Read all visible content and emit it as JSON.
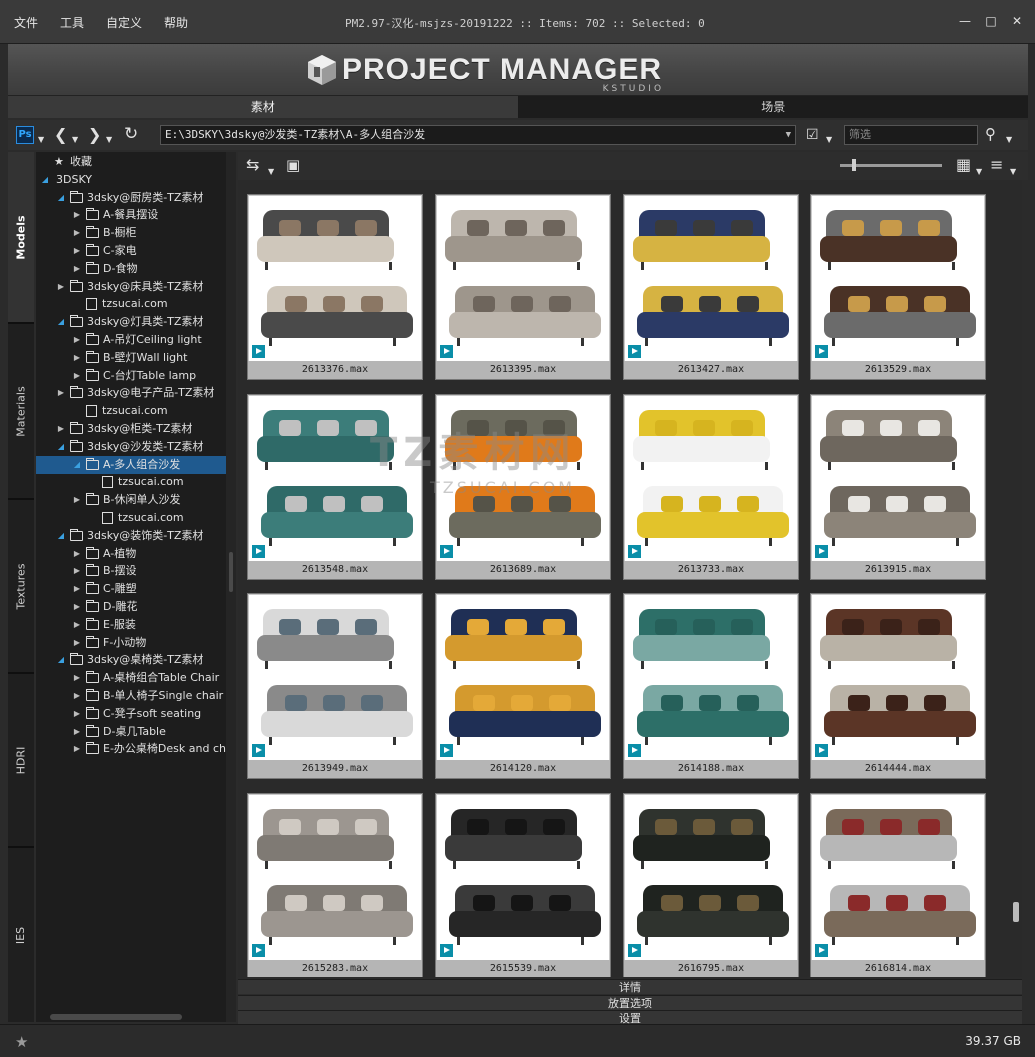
{
  "menu": [
    "文件",
    "工具",
    "自定义",
    "帮助"
  ],
  "window_title": "PM2.97-汉化-msjzs-20191222  :: Items: 702  :: Selected: 0",
  "window_controls": [
    "minimize-icon",
    "maximize-icon",
    "close-icon"
  ],
  "banner": {
    "logo_text": "PROJECT MANAGER",
    "logo_sub": "KSTUDIO"
  },
  "main_tabs": [
    {
      "label": "素材",
      "active": true
    },
    {
      "label": "场景",
      "active": false
    }
  ],
  "toolbar": {
    "ps_label": "Ps",
    "path": "E:\\3DSKY\\3dsky@沙发类-TZ素材\\A-多人组合沙发",
    "filter_placeholder": "筛选"
  },
  "side_tabs": [
    "Models",
    "Materials",
    "Textures",
    "HDRI",
    "IES"
  ],
  "tree": [
    {
      "label": "收藏",
      "indent": 0,
      "type": "fav",
      "arrow": ""
    },
    {
      "label": "3DSKY",
      "indent": 0,
      "type": "none",
      "arrow": "open"
    },
    {
      "label": "3dsky@厨房类-TZ素材",
      "indent": 1,
      "type": "folder",
      "arrow": "open"
    },
    {
      "label": "A-餐具摆设",
      "indent": 2,
      "type": "folder",
      "arrow": "closed"
    },
    {
      "label": "B-橱柜",
      "indent": 2,
      "type": "folder",
      "arrow": "closed"
    },
    {
      "label": "C-家电",
      "indent": 2,
      "type": "folder",
      "arrow": "closed"
    },
    {
      "label": "D-食物",
      "indent": 2,
      "type": "folder",
      "arrow": "closed"
    },
    {
      "label": "3dsky@床具类-TZ素材",
      "indent": 1,
      "type": "folder",
      "arrow": "closed"
    },
    {
      "label": "tzsucai.com",
      "indent": 2,
      "type": "file",
      "arrow": ""
    },
    {
      "label": "3dsky@灯具类-TZ素材",
      "indent": 1,
      "type": "folder",
      "arrow": "open"
    },
    {
      "label": "A-吊灯Ceiling light",
      "indent": 2,
      "type": "folder",
      "arrow": "closed"
    },
    {
      "label": "B-壁灯Wall light",
      "indent": 2,
      "type": "folder",
      "arrow": "closed"
    },
    {
      "label": "C-台灯Table lamp",
      "indent": 2,
      "type": "folder",
      "arrow": "closed"
    },
    {
      "label": "3dsky@电子产品-TZ素材",
      "indent": 1,
      "type": "folder",
      "arrow": "closed"
    },
    {
      "label": "tzsucai.com",
      "indent": 2,
      "type": "file",
      "arrow": ""
    },
    {
      "label": "3dsky@柜类-TZ素材",
      "indent": 1,
      "type": "folder",
      "arrow": "closed"
    },
    {
      "label": "3dsky@沙发类-TZ素材",
      "indent": 1,
      "type": "folder",
      "arrow": "open"
    },
    {
      "label": "A-多人组合沙发",
      "indent": 2,
      "type": "folder",
      "arrow": "open",
      "selected": true
    },
    {
      "label": "tzsucai.com",
      "indent": 3,
      "type": "file",
      "arrow": ""
    },
    {
      "label": "B-休闲单人沙发",
      "indent": 2,
      "type": "folder",
      "arrow": "closed"
    },
    {
      "label": "tzsucai.com",
      "indent": 3,
      "type": "file",
      "arrow": ""
    },
    {
      "label": "3dsky@装饰类-TZ素材",
      "indent": 1,
      "type": "folder",
      "arrow": "open"
    },
    {
      "label": "A-植物",
      "indent": 2,
      "type": "folder",
      "arrow": "closed"
    },
    {
      "label": "B-摆设",
      "indent": 2,
      "type": "folder",
      "arrow": "closed"
    },
    {
      "label": "C-雕塑",
      "indent": 2,
      "type": "folder",
      "arrow": "closed"
    },
    {
      "label": "D-雕花",
      "indent": 2,
      "type": "folder",
      "arrow": "closed"
    },
    {
      "label": "E-服装",
      "indent": 2,
      "type": "folder",
      "arrow": "closed"
    },
    {
      "label": "F-小动物",
      "indent": 2,
      "type": "folder",
      "arrow": "closed"
    },
    {
      "label": "3dsky@桌椅类-TZ素材",
      "indent": 1,
      "type": "folder",
      "arrow": "open"
    },
    {
      "label": "A-桌椅组合Table Chair",
      "indent": 2,
      "type": "folder",
      "arrow": "closed"
    },
    {
      "label": "B-单人椅子Single chair",
      "indent": 2,
      "type": "folder",
      "arrow": "closed"
    },
    {
      "label": "C-凳子soft seating",
      "indent": 2,
      "type": "folder",
      "arrow": "closed"
    },
    {
      "label": "D-桌几Table",
      "indent": 2,
      "type": "folder",
      "arrow": "closed"
    },
    {
      "label": "E-办公桌椅Desk and chair",
      "indent": 2,
      "type": "folder",
      "arrow": "closed"
    }
  ],
  "items": [
    {
      "file": "2613376.max",
      "palette": [
        "#4a4a4a",
        "#cfc7bb",
        "#8b7764"
      ]
    },
    {
      "file": "2613395.max",
      "palette": [
        "#bdb6ad",
        "#9e968c",
        "#6e655c"
      ]
    },
    {
      "file": "2613427.max",
      "palette": [
        "#2b3a66",
        "#d6b342",
        "#3a3a3a"
      ]
    },
    {
      "file": "2613529.max",
      "palette": [
        "#6b6b6b",
        "#4a3226",
        "#c79a4a"
      ]
    },
    {
      "file": "2613548.max",
      "palette": [
        "#3c7d7a",
        "#2f6a68",
        "#c0c0c0"
      ]
    },
    {
      "file": "2613689.max",
      "palette": [
        "#6c6b5e",
        "#e07a1a",
        "#555348"
      ]
    },
    {
      "file": "2613733.max",
      "palette": [
        "#e2c32b",
        "#f2f2f2",
        "#d6b41f"
      ]
    },
    {
      "file": "2613915.max",
      "palette": [
        "#8c8479",
        "#6e675e",
        "#e8e6e2"
      ]
    },
    {
      "file": "2613949.max",
      "palette": [
        "#d9d9d9",
        "#8a8a8a",
        "#5a6d7a"
      ]
    },
    {
      "file": "2614120.max",
      "palette": [
        "#1f2f55",
        "#d49a2e",
        "#e4a938"
      ]
    },
    {
      "file": "2614188.max",
      "palette": [
        "#2d6f68",
        "#7aa8a3",
        "#26605a"
      ]
    },
    {
      "file": "2614444.max",
      "palette": [
        "#5b3526",
        "#b9b2a6",
        "#3b2219"
      ]
    },
    {
      "file": "2615283.max",
      "palette": [
        "#9c9690",
        "#7f7a74",
        "#cfc9c2"
      ]
    },
    {
      "file": "2615539.max",
      "palette": [
        "#262626",
        "#3a3a3a",
        "#151515"
      ]
    },
    {
      "file": "2616795.max",
      "palette": [
        "#2f332e",
        "#1f231f",
        "#6b5a3a"
      ]
    },
    {
      "file": "2616814.max",
      "palette": [
        "#7a6a5a",
        "#b7b7b7",
        "#8a2a2a"
      ]
    }
  ],
  "bottom_panels": [
    "详情",
    "放置选项",
    "设置"
  ],
  "status": {
    "disk_space": "39.37 GB"
  },
  "watermark": {
    "text": "TZ素材网",
    "sub": "TZSUCAI.COM"
  }
}
